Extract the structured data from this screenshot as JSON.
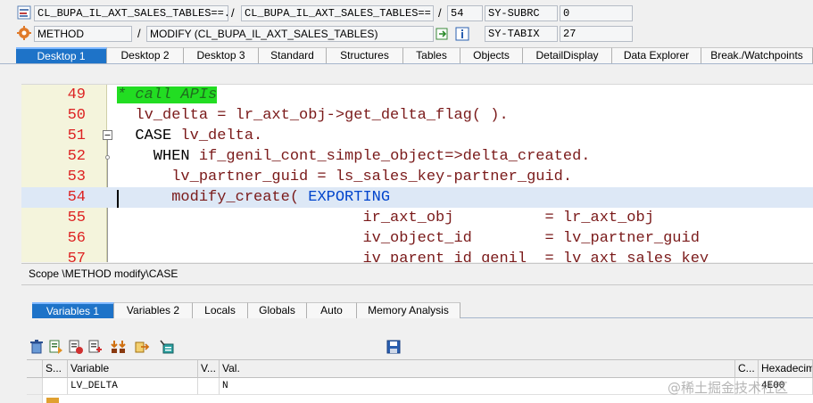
{
  "header": {
    "program_field": "CL_BUPA_IL_AXT_SALES_TABLES==...",
    "sep1": "/",
    "include_field": "CL_BUPA_IL_AXT_SALES_TABLES==...",
    "sep2": "/",
    "line_field": "54",
    "sysvar1_name": "SY-SUBRC",
    "sysvar1_value": "0",
    "event_type": "METHOD",
    "sep3": "/",
    "event_name": "MODIFY (CL_BUPA_IL_AXT_SALES_TABLES)",
    "sysvar2_name": "SY-TABIX",
    "sysvar2_value": "27"
  },
  "tabs": [
    {
      "label": "Desktop 1",
      "active": true
    },
    {
      "label": "Desktop 2"
    },
    {
      "label": "Desktop 3"
    },
    {
      "label": "Standard"
    },
    {
      "label": "Structures"
    },
    {
      "label": "Tables"
    },
    {
      "label": "Objects"
    },
    {
      "label": "DetailDisplay"
    },
    {
      "label": "Data Explorer"
    },
    {
      "label": "Break./Watchpoints"
    }
  ],
  "editor": {
    "lines": [
      {
        "num": "49",
        "parts": [
          {
            "t": "* call APIs",
            "c": "cmt"
          }
        ]
      },
      {
        "num": "50",
        "parts": [
          {
            "t": "  lv_delta = lr_axt_obj->get_delta_flag( ).",
            "c": ""
          }
        ]
      },
      {
        "num": "51",
        "parts": [
          {
            "t": "  CASE ",
            "c": "kw"
          },
          {
            "t": "lv_delta.",
            "c": ""
          }
        ]
      },
      {
        "num": "52",
        "parts": [
          {
            "t": "    WHEN ",
            "c": "kw"
          },
          {
            "t": "if_genil_cont_simple_object=>delta_created.",
            "c": ""
          }
        ]
      },
      {
        "num": "53",
        "parts": [
          {
            "t": "      lv_partner_guid = ls_sales_key-partner_guid.",
            "c": ""
          }
        ]
      },
      {
        "num": "54",
        "parts": [
          {
            "t": "      modify_create( ",
            "c": ""
          },
          {
            "t": "EXPORTING",
            "c": "kwb"
          }
        ]
      },
      {
        "num": "55",
        "parts": [
          {
            "t": "                           ir_axt_obj          = lr_axt_obj",
            "c": ""
          }
        ]
      },
      {
        "num": "56",
        "parts": [
          {
            "t": "                           iv_object_id        = lv_partner_guid",
            "c": ""
          }
        ]
      },
      {
        "num": "57",
        "parts": [
          {
            "t": "                           iv_parent_id_genil  = lv_axt_sales_key",
            "c": ""
          }
        ]
      }
    ]
  },
  "scope_text": "Scope \\METHOD modify\\CASE",
  "var_tabs": [
    {
      "label": "Variables 1",
      "active": true
    },
    {
      "label": "Variables 2"
    },
    {
      "label": "Locals"
    },
    {
      "label": "Globals"
    },
    {
      "label": "Auto"
    },
    {
      "label": "Memory Analysis"
    }
  ],
  "toolbar_icons": [
    "delete-icon",
    "details-icon",
    "reset-icon",
    "copy-icon",
    "move-icon",
    "export-icon",
    "filter-icon"
  ],
  "save_icon": "save-icon",
  "grid": {
    "headers": {
      "s": "S...",
      "variable": "Variable",
      "v": "V...",
      "val": "Val.",
      "c": "C...",
      "hex": "Hexadecim"
    },
    "rows": [
      {
        "variable": "LV_DELTA",
        "val": "N",
        "hex": "4E00"
      }
    ]
  },
  "watermark": "@稀土掘金技术社区",
  "colors": {
    "active_tab": "#1e73c8",
    "comment_bg": "#22dd22",
    "line_number": "#dd2222",
    "keyword_blue": "#0044cc",
    "code_text": "#7a1a1a"
  }
}
